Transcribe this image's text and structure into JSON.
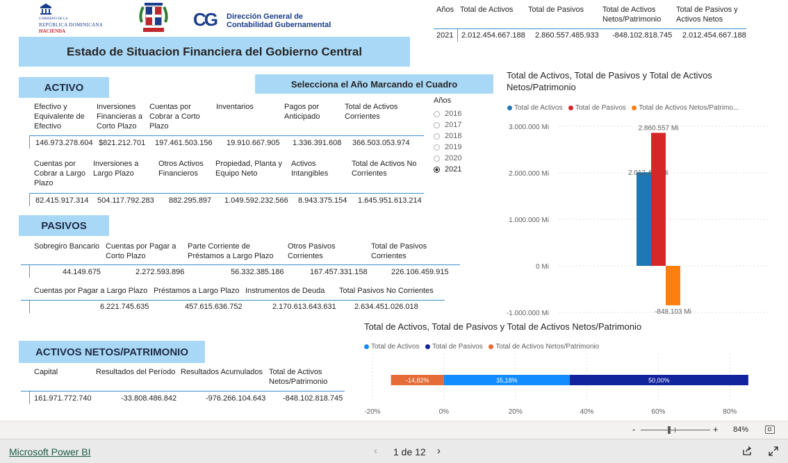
{
  "logos": {
    "hacienda_line1": "GOBIERNO DE LA",
    "hacienda_line2": "REPÚBLICA DOMINICANA",
    "hacienda_line3": "HACIENDA",
    "dgcg_line1": "Dirección General de",
    "dgcg_line2": "Contabilidad Gubernamental",
    "dgcg_mark": "CG"
  },
  "report_title": "Estado de Situacion Financiera del Gobierno Central",
  "top_table": {
    "headers": [
      "Años",
      "Total de Activos",
      "Total de Pasivos",
      "Total de Activos Netos/Patrimonio",
      "Total de Pasivos y Activos Netos"
    ],
    "row": [
      "2021",
      "2.012.454.667.188",
      "2.860.557.485.933",
      "-848.102.818.745",
      "2.012.454.667.188"
    ]
  },
  "activo": {
    "title": "ACTIVO",
    "row1_labels": [
      "Efectivo y Equivalente de Efectivo",
      "Inversiones Financieras a Corto Plazo",
      "Cuentas por Cobrar a Corto Plazo",
      "Inventarios",
      "Pagos por Anticipado",
      "Total de Activos Corrientes"
    ],
    "row1_values": [
      "146.973.278.604",
      "$821.212.701",
      "197.461.503.156",
      "19.910.667.905",
      "1.336.391.608",
      "366.503.053.974"
    ],
    "row2_labels": [
      "Cuentas por Cobrar a Largo Plazo",
      "Inversiones a Largo Plazo",
      "Otros Activos Financieros",
      "Propiedad, Planta y Equipo Neto",
      "Activos Intangibles",
      "Total de Activos No Corrientes"
    ],
    "row2_values": [
      "82.415.917.314",
      "504.117.792.283",
      "882.295.897",
      "1.049.592.232.566",
      "8.943.375.154",
      "1.645.951.613.214"
    ]
  },
  "selector": {
    "banner": "Selecciona el Año Marcando el Cuadro",
    "title": "Años",
    "options": [
      "2016",
      "2017",
      "2018",
      "2019",
      "2020",
      "2021"
    ],
    "selected": "2021"
  },
  "pasivos": {
    "title": "PASIVOS",
    "row1_labels": [
      "Sobregiro Bancario",
      "Cuentas por Pagar a Corto Plazo",
      "Parte Corriente de Préstamos a Largo Plazo",
      "Otros Pasivos Corrientes",
      "Total de Pasivos Corrientes"
    ],
    "row1_values": [
      "44.149.675",
      "2.272.593.896",
      "56.332.385.186",
      "167.457.331.158",
      "226.106.459.915"
    ],
    "row2_labels": [
      "Cuentas por Pagar a Largo Plazo",
      "Préstamos a Largo Plazo",
      "Instrumentos de Deuda",
      "Total Pasivos No Corrientes"
    ],
    "row2_values": [
      "6.221.745.635",
      "457.615.636.752",
      "2.170.613.643.631",
      "2.634.451.026.018"
    ]
  },
  "patrimonio": {
    "title": "ACTIVOS NETOS/PATRIMONIO",
    "labels": [
      "Capital",
      "Resultados del Período",
      "Resultados Acumulados",
      "Total de Activos Netos/Patrimonio"
    ],
    "values": [
      "161.971.772.740",
      "-33.808.486.842",
      "-976.266.104.643",
      "-848.102.818.745"
    ]
  },
  "colors": {
    "activos": "#1f77b4",
    "pasivos": "#d62728",
    "patrimonio": "#ff7f0e",
    "bar2_activos": "#118dff",
    "bar2_pasivos": "#12239e",
    "bar2_patrimonio": "#e66c37",
    "band": "#a9d8f7"
  },
  "chart_data": [
    {
      "type": "bar",
      "title": "Total de Activos, Total de Pasivos y Total de Activos Netos/Patrimonio",
      "legend": [
        "Total de  Activos",
        "Total de Pasivos",
        "Total de Activos Netos/Patrimo..."
      ],
      "legend_placement": "top-left",
      "series": [
        {
          "name": "Total de  Activos",
          "values": [
            2012454
          ]
        },
        {
          "name": "Total de Pasivos",
          "values": [
            2860557
          ]
        },
        {
          "name": "Total de Activos Netos/Patrimonio",
          "values": [
            -848103
          ]
        }
      ],
      "data_labels": [
        "2.012.455 Mi",
        "2.860.557 Mi",
        "-848.103 Mi"
      ],
      "yticks": [
        "3.000.000 Mi",
        "2.000.000 Mi",
        "1.000.000 Mi",
        "0 Mi",
        "-1.000.000 Mi"
      ],
      "ylim": [
        -1000000,
        3000000
      ],
      "grid": true
    },
    {
      "type": "bar",
      "orientation": "horizontal-stacked",
      "title": "Total de Activos, Total de Pasivos y Total de Activos Netos/Patrimonio",
      "legend": [
        "Total de  Activos",
        "Total de Pasivos",
        "Total de Activos Netos/Patrimonio"
      ],
      "legend_placement": "top-left",
      "series": [
        {
          "name": "Total de Activos Netos/Patrimonio",
          "values": [
            -14.82
          ]
        },
        {
          "name": "Total de  Activos",
          "values": [
            35.18
          ]
        },
        {
          "name": "Total de Pasivos",
          "values": [
            50.0
          ]
        }
      ],
      "data_labels": [
        "-14,82%",
        "35,18%",
        "50,00%"
      ],
      "xticks": [
        "-20%",
        "0%",
        "20%",
        "40%",
        "60%",
        "80%"
      ],
      "xlim": [
        -20,
        85
      ],
      "grid": true
    }
  ],
  "status": {
    "zoom_minus": "-",
    "zoom_plus": "+",
    "zoom": "84%"
  },
  "footer": {
    "brand": "Microsoft Power BI",
    "page": "1 de 12"
  }
}
